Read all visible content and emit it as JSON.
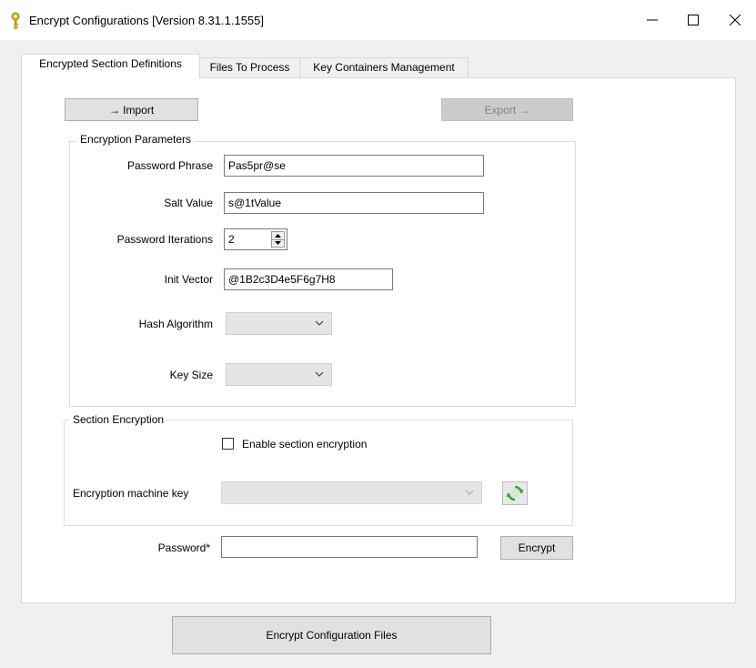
{
  "window": {
    "title": "Encrypt Configurations [Version 8.31.1.1555]",
    "icon": "key-icon",
    "controls": [
      "minimize-icon",
      "maximize-icon",
      "close-icon"
    ]
  },
  "tabs": [
    {
      "label": "Encrypted Section Definitions",
      "active": true
    },
    {
      "label": "Files To Process",
      "active": false
    },
    {
      "label": "Key Containers Management",
      "active": false
    }
  ],
  "toolbar": {
    "import_label": "→ Import",
    "export_label": "Export →"
  },
  "encryption_parameters": {
    "title": "Encryption Parameters",
    "password_phrase": {
      "label": "Password Phrase",
      "value": "Pas5pr@se"
    },
    "salt_value": {
      "label": "Salt Value",
      "value": "s@1tValue"
    },
    "password_iterations": {
      "label": "Password Iterations",
      "value": "2"
    },
    "init_vector": {
      "label": "Init Vector",
      "value": "@1B2c3D4e5F6g7H8"
    },
    "hash_algorithm": {
      "label": "Hash Algorithm",
      "value": ""
    },
    "key_size": {
      "label": "Key Size",
      "value": ""
    }
  },
  "section_encryption": {
    "title": "Section Encryption",
    "enable_label": "Enable section encryption",
    "enabled": false,
    "machine_key_label": "Encryption machine key",
    "machine_key_value": "",
    "refresh_icon": "refresh-icon"
  },
  "password_row": {
    "label": "Password*",
    "value": "",
    "encrypt_label": "Encrypt"
  },
  "footer": {
    "encrypt_files_label": "Encrypt Configuration Files"
  },
  "colors": {
    "window_bg": "#f0f0f0",
    "panel_bg": "#ffffff",
    "button_bg": "#e1e1e1",
    "disabled_bg": "#cccccc",
    "refresh_green": "#3fa535"
  }
}
